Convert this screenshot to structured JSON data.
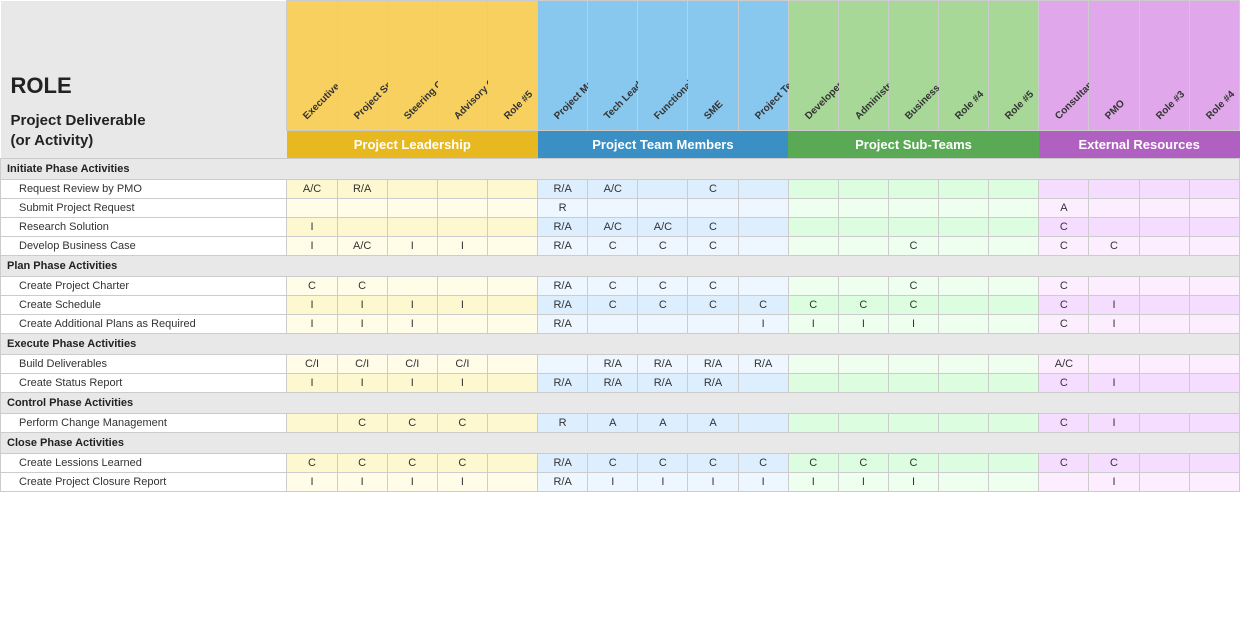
{
  "title": "ROLE",
  "deliverable_label": "Project Deliverable\n(or Activity)",
  "groups": [
    {
      "label": "Project Leadership",
      "color": "gh-leadership",
      "span": 5
    },
    {
      "label": "Project Team Members",
      "color": "gh-team",
      "span": 5
    },
    {
      "label": "Project Sub-Teams",
      "color": "gh-subteam",
      "span": 5
    },
    {
      "label": "External Resources",
      "color": "gh-external",
      "span": 4
    }
  ],
  "columns": [
    {
      "label": "Executive Sponsor",
      "group": "leadership"
    },
    {
      "label": "Project Sponsor",
      "group": "leadership"
    },
    {
      "label": "Steering Committee",
      "group": "leadership"
    },
    {
      "label": "Advisory Committee",
      "group": "leadership"
    },
    {
      "label": "Role #5",
      "group": "leadership"
    },
    {
      "label": "Project Manager",
      "group": "team"
    },
    {
      "label": "Tech Lead",
      "group": "team"
    },
    {
      "label": "Functional Lead",
      "group": "team"
    },
    {
      "label": "SME",
      "group": "team"
    },
    {
      "label": "Project Team Member",
      "group": "team"
    },
    {
      "label": "Developer",
      "group": "subteam"
    },
    {
      "label": "Administrative Support",
      "group": "subteam"
    },
    {
      "label": "Business Analyst",
      "group": "subteam"
    },
    {
      "label": "Role #4",
      "group": "subteam"
    },
    {
      "label": "Role #5",
      "group": "subteam"
    },
    {
      "label": "Consultant",
      "group": "external"
    },
    {
      "label": "PMO",
      "group": "external"
    },
    {
      "label": "Role #3",
      "group": "external"
    },
    {
      "label": "Role #4",
      "group": "external"
    }
  ],
  "rows": [
    {
      "type": "phase",
      "label": "Initiate Phase Activities"
    },
    {
      "type": "activity",
      "label": "Request Review by PMO",
      "cells": [
        "A/C",
        "R/A",
        "",
        "",
        "",
        "R/A",
        "A/C",
        "",
        "C",
        "",
        "",
        "",
        "",
        "",
        "",
        "",
        "",
        "",
        ""
      ]
    },
    {
      "type": "activity",
      "label": "Submit Project Request",
      "cells": [
        "",
        "",
        "",
        "",
        "",
        "R",
        "",
        "",
        "",
        "",
        "",
        "",
        "",
        "",
        "",
        "A",
        "",
        "",
        ""
      ]
    },
    {
      "type": "activity",
      "label": "Research Solution",
      "cells": [
        "I",
        "",
        "",
        "",
        "",
        "R/A",
        "A/C",
        "A/C",
        "C",
        "",
        "",
        "",
        "",
        "",
        "",
        "C",
        "",
        "",
        ""
      ]
    },
    {
      "type": "activity",
      "label": "Develop Business Case",
      "cells": [
        "I",
        "A/C",
        "I",
        "I",
        "",
        "R/A",
        "C",
        "C",
        "C",
        "",
        "",
        "",
        "C",
        "",
        "",
        "C",
        "C",
        "",
        ""
      ]
    },
    {
      "type": "phase",
      "label": "Plan Phase Activities"
    },
    {
      "type": "activity",
      "label": "Create Project Charter",
      "cells": [
        "C",
        "C",
        "",
        "",
        "",
        "R/A",
        "C",
        "C",
        "C",
        "",
        "",
        "",
        "C",
        "",
        "",
        "C",
        "",
        "",
        ""
      ]
    },
    {
      "type": "activity",
      "label": "Create Schedule",
      "cells": [
        "I",
        "I",
        "I",
        "I",
        "",
        "R/A",
        "C",
        "C",
        "C",
        "C",
        "C",
        "C",
        "C",
        "",
        "",
        "C",
        "I",
        "",
        ""
      ]
    },
    {
      "type": "activity",
      "label": "Create Additional Plans as Required",
      "cells": [
        "I",
        "I",
        "I",
        "",
        "",
        "R/A",
        "",
        "",
        "",
        "I",
        "I",
        "I",
        "I",
        "",
        "",
        "C",
        "I",
        "",
        ""
      ]
    },
    {
      "type": "phase",
      "label": "Execute Phase Activities"
    },
    {
      "type": "activity",
      "label": "Build Deliverables",
      "cells": [
        "C/I",
        "C/I",
        "C/I",
        "C/I",
        "",
        "",
        "R/A",
        "R/A",
        "R/A",
        "R/A",
        "",
        "",
        "",
        "",
        "",
        "A/C",
        "",
        "",
        ""
      ]
    },
    {
      "type": "activity",
      "label": "Create Status Report",
      "cells": [
        "I",
        "I",
        "I",
        "I",
        "",
        "R/A",
        "R/A",
        "R/A",
        "R/A",
        "",
        "",
        "",
        "",
        "",
        "",
        "C",
        "I",
        "",
        ""
      ]
    },
    {
      "type": "phase",
      "label": "Control Phase Activities"
    },
    {
      "type": "activity",
      "label": "Perform Change Management",
      "cells": [
        "",
        "C",
        "C",
        "C",
        "",
        "R",
        "A",
        "A",
        "A",
        "",
        "",
        "",
        "",
        "",
        "",
        "C",
        "I",
        "",
        ""
      ]
    },
    {
      "type": "phase",
      "label": "Close Phase Activities"
    },
    {
      "type": "activity",
      "label": "Create Lessions Learned",
      "cells": [
        "C",
        "C",
        "C",
        "C",
        "",
        "R/A",
        "C",
        "C",
        "C",
        "C",
        "C",
        "C",
        "C",
        "",
        "",
        "C",
        "C",
        "",
        ""
      ]
    },
    {
      "type": "activity",
      "label": "Create Project Closure Report",
      "cells": [
        "I",
        "I",
        "I",
        "I",
        "",
        "R/A",
        "I",
        "I",
        "I",
        "I",
        "I",
        "I",
        "I",
        "",
        "",
        "",
        "I",
        "",
        ""
      ]
    }
  ]
}
